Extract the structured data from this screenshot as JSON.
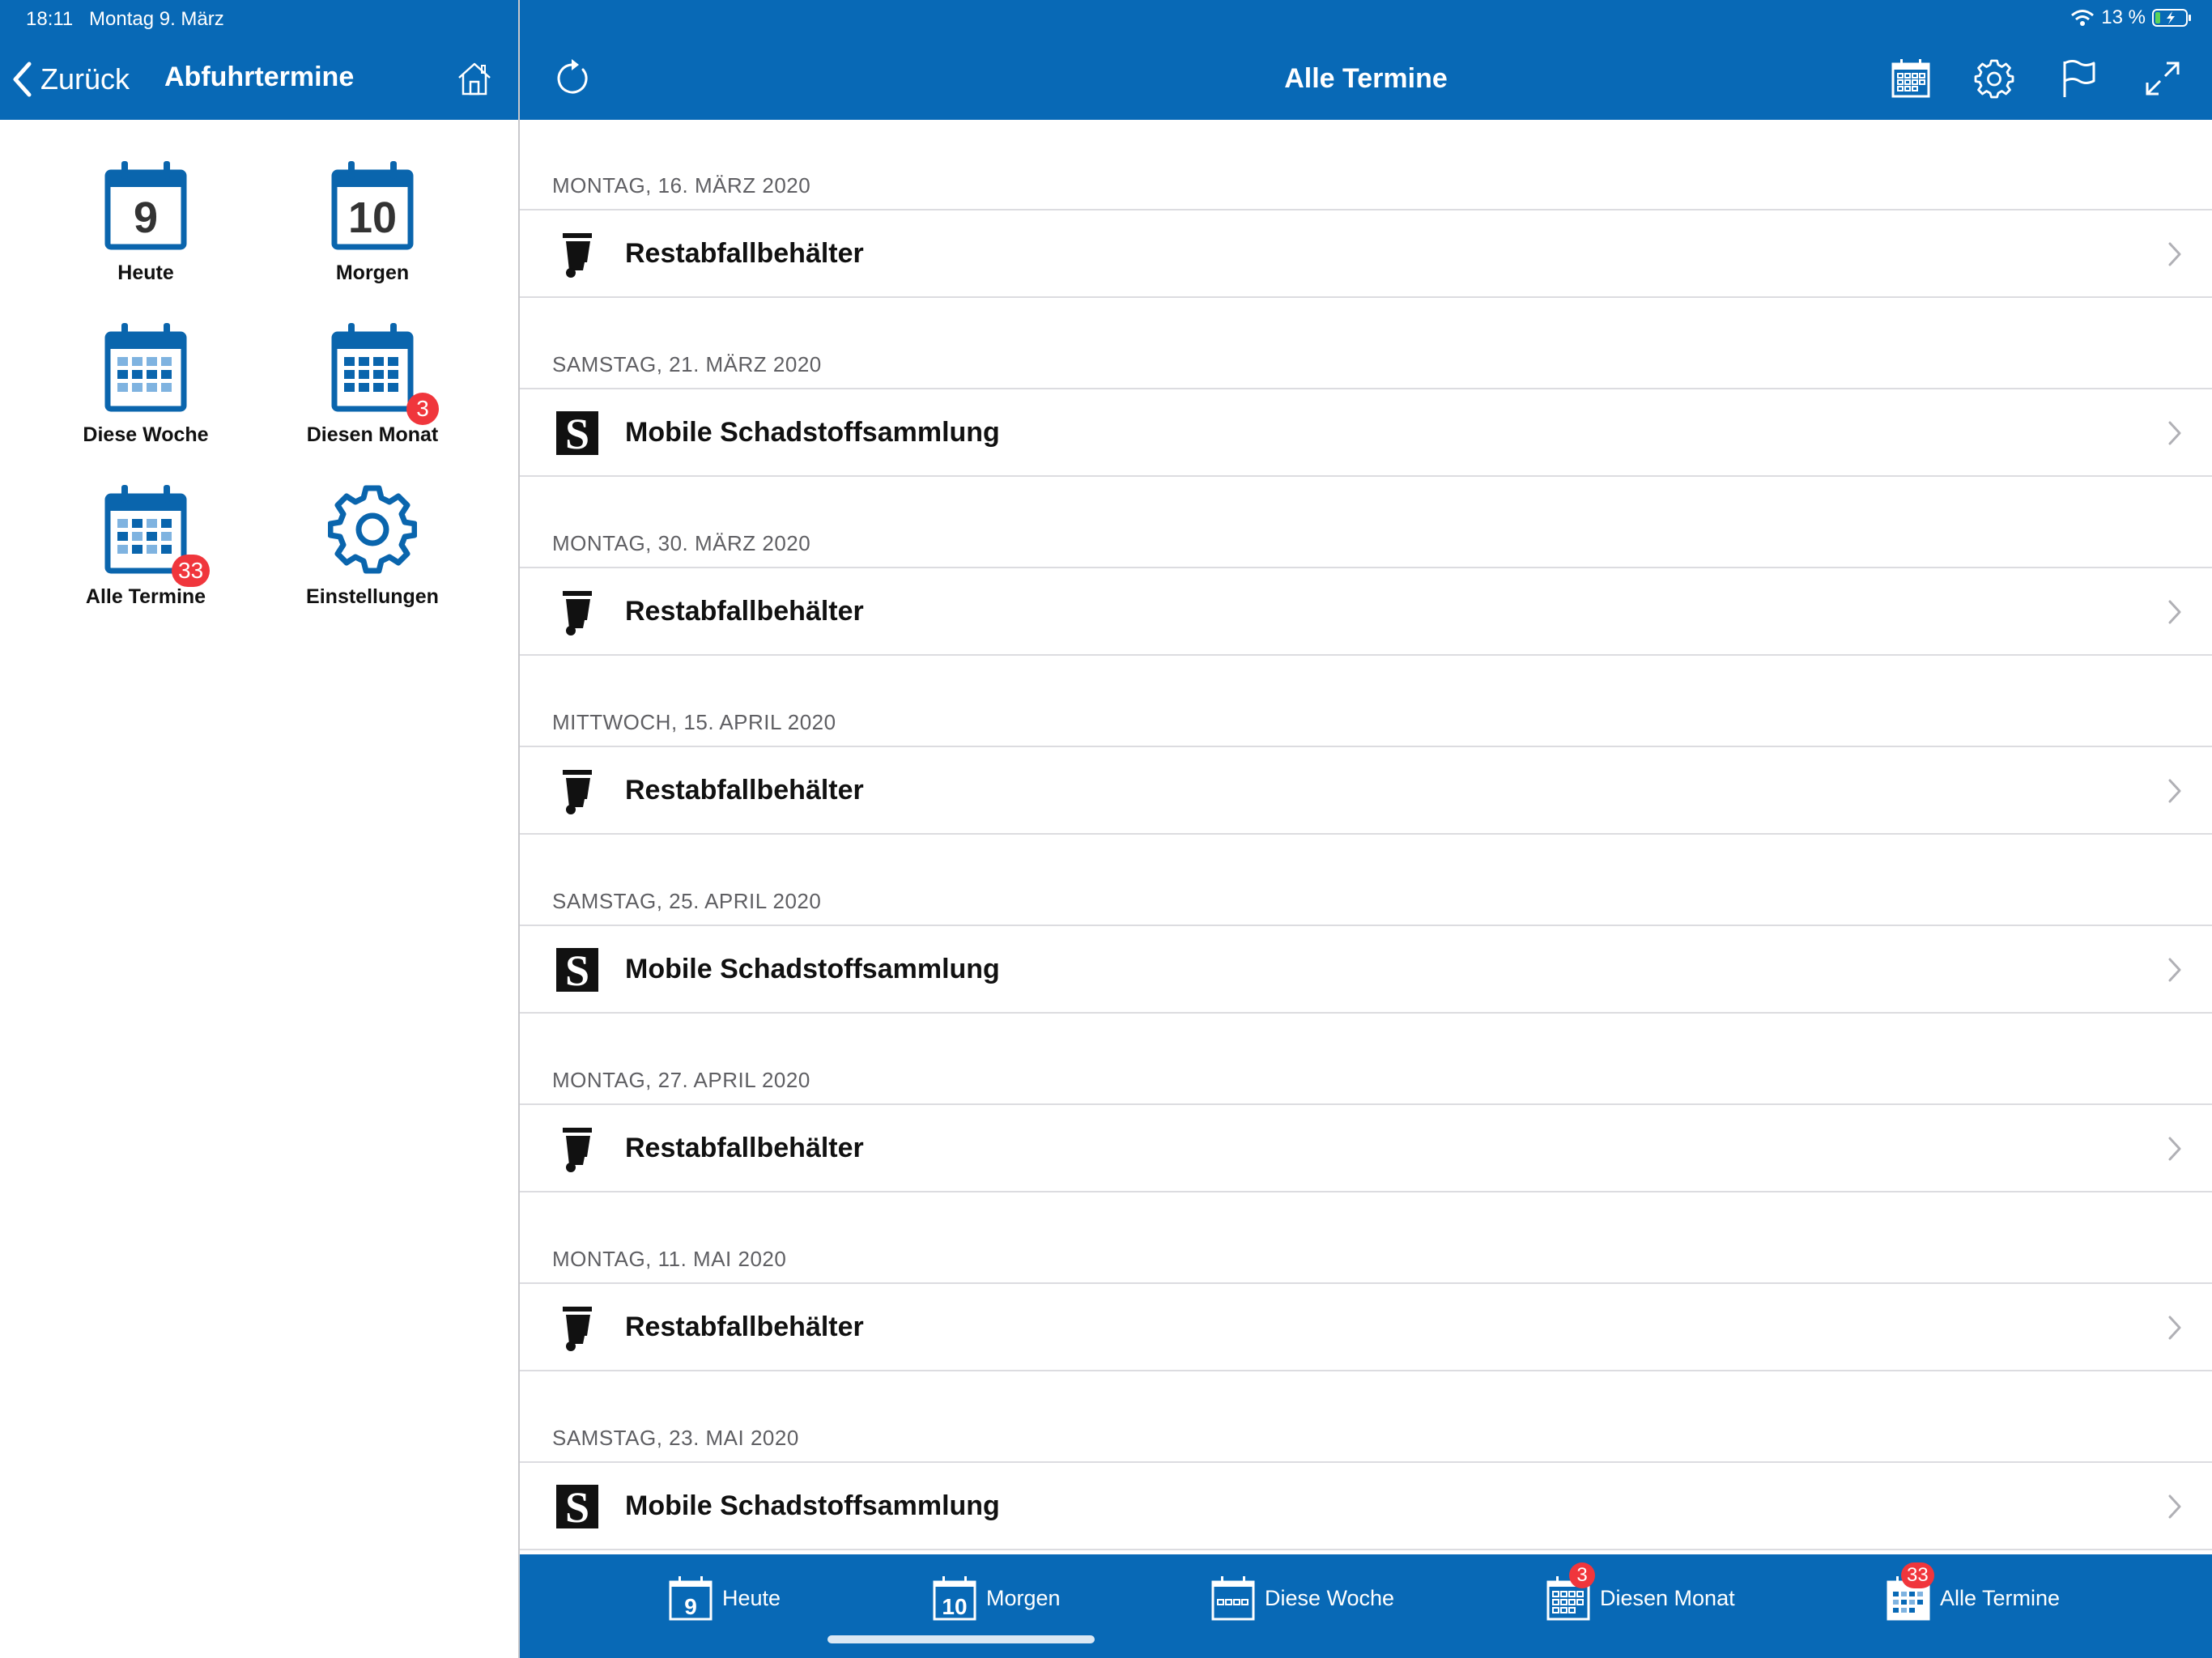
{
  "status_bar": {
    "time": "18:11",
    "date": "Montag 9. März",
    "battery": "13 %"
  },
  "left_pane": {
    "back_label": "Zurück",
    "title": "Abfuhrtermine",
    "tiles": [
      {
        "label": "Heute",
        "icon": "calendar-day-icon",
        "day": "9"
      },
      {
        "label": "Morgen",
        "icon": "calendar-day-icon",
        "day": "10"
      },
      {
        "label": "Diese Woche",
        "icon": "calendar-week-icon"
      },
      {
        "label": "Diesen Monat",
        "icon": "calendar-month-icon",
        "badge": "3"
      },
      {
        "label": "Alle Termine",
        "icon": "calendar-all-icon",
        "badge": "33"
      },
      {
        "label": "Einstellungen",
        "icon": "gear-icon"
      }
    ]
  },
  "right_pane": {
    "title": "Alle Termine",
    "toolbar_icons": [
      "refresh-icon",
      "calendar-icon",
      "gear-icon",
      "flag-icon",
      "expand-icon"
    ],
    "sections": [
      {
        "header": "MONTAG, 16. MÄRZ 2020",
        "item": "Restabfallbehälter",
        "icon": "waste-bin-icon"
      },
      {
        "header": "SAMSTAG, 21. MÄRZ 2020",
        "item": "Mobile Schadstoffsammlung",
        "icon": "hazardous-waste-icon"
      },
      {
        "header": "MONTAG, 30. MÄRZ 2020",
        "item": "Restabfallbehälter",
        "icon": "waste-bin-icon"
      },
      {
        "header": "MITTWOCH, 15. APRIL 2020",
        "item": "Restabfallbehälter",
        "icon": "waste-bin-icon"
      },
      {
        "header": "SAMSTAG, 25. APRIL 2020",
        "item": "Mobile Schadstoffsammlung",
        "icon": "hazardous-waste-icon"
      },
      {
        "header": "MONTAG, 27. APRIL 2020",
        "item": "Restabfallbehälter",
        "icon": "waste-bin-icon"
      },
      {
        "header": "MONTAG, 11. MAI 2020",
        "item": "Restabfallbehälter",
        "icon": "waste-bin-icon"
      },
      {
        "header": "SAMSTAG, 23. MAI 2020",
        "item": "Mobile Schadstoffsammlung",
        "icon": "hazardous-waste-icon"
      }
    ]
  },
  "tab_bar": {
    "tabs": [
      {
        "label": "Heute",
        "day": "9"
      },
      {
        "label": "Morgen",
        "day": "10"
      },
      {
        "label": "Diese Woche"
      },
      {
        "label": "Diesen Monat",
        "badge": "3"
      },
      {
        "label": "Alle Termine",
        "badge": "33"
      }
    ]
  },
  "colors": {
    "brand_blue": "#0869b6",
    "badge_red": "#f0363c",
    "section_header": "#5f5f63"
  }
}
